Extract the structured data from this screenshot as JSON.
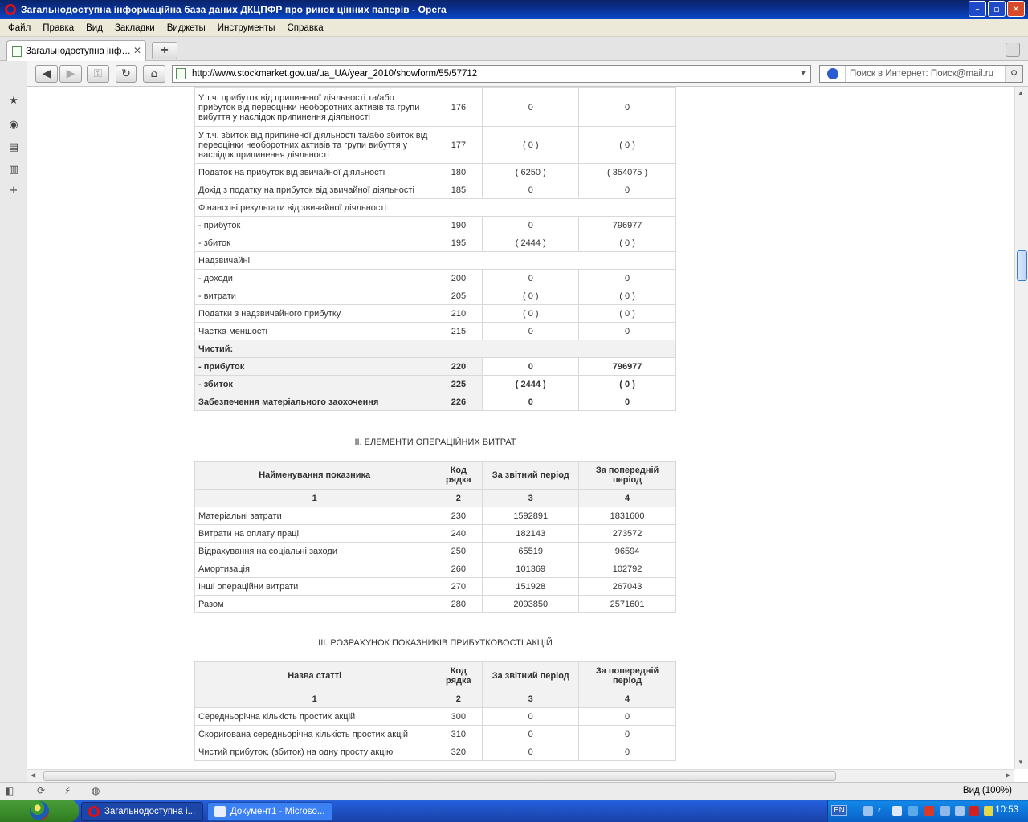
{
  "window": {
    "title": "Загальнодоступна інформаційна база даних ДКЦПФР про ринок цінних паперів - Opera",
    "buttons": [
      "–",
      "▫",
      "✕"
    ]
  },
  "menu": [
    "Файл",
    "Правка",
    "Вид",
    "Закладки",
    "Виджеты",
    "Инструменты",
    "Справка"
  ],
  "tab": {
    "label": "Загальнодоступна інф…"
  },
  "address": {
    "url": "http://www.stockmarket.gov.ua/ua_UA/year_2010/showform/55/57712"
  },
  "search": {
    "placeholder": "Поиск в Интернет: Поиск@mail.ru"
  },
  "table1": {
    "rows": [
      {
        "label": "У т.ч. прибуток від припиненої діяльності та/або прибуток від переоцінки необоротних активів та групи вибуття у наслідок припинення діяльності",
        "code": "176",
        "cur": "0",
        "prev": "0",
        "style": "tall"
      },
      {
        "label": "У т.ч. збиток від припиненої діяльності та/або збиток від переоцінки необоротних активів та групи вибуття у наслідок припинення діяльності",
        "code": "177",
        "cur": "( 0 )",
        "prev": "( 0 )",
        "style": "tall"
      },
      {
        "label": "Податок на прибуток від звичайної діяльності",
        "code": "180",
        "cur": "( 6250 )",
        "prev": "( 354075 )",
        "style": ""
      },
      {
        "label": "Дохід з податку на прибуток від звичайної діяльності",
        "code": "185",
        "cur": "0",
        "prev": "0",
        "style": ""
      },
      {
        "label": "Фінансові результати від звичайної діяльності:",
        "code": "",
        "cur": "",
        "prev": "",
        "style": "span"
      },
      {
        "label": "- прибуток",
        "code": "190",
        "cur": "0",
        "prev": "796977",
        "style": ""
      },
      {
        "label": "- збиток",
        "code": "195",
        "cur": "( 2444 )",
        "prev": "( 0 )",
        "style": ""
      },
      {
        "label": "Надзвичайні:",
        "code": "",
        "cur": "",
        "prev": "",
        "style": "span"
      },
      {
        "label": "- доходи",
        "code": "200",
        "cur": "0",
        "prev": "0",
        "style": ""
      },
      {
        "label": "- витрати",
        "code": "205",
        "cur": "( 0 )",
        "prev": "( 0 )",
        "style": ""
      },
      {
        "label": "Податки з надзвичайного прибутку",
        "code": "210",
        "cur": "( 0 )",
        "prev": "( 0 )",
        "style": ""
      },
      {
        "label": "Частка меншості",
        "code": "215",
        "cur": "0",
        "prev": "0",
        "style": ""
      },
      {
        "label": "Чистий:",
        "code": "",
        "cur": "",
        "prev": "",
        "style": "span-bold"
      },
      {
        "label": "- прибуток",
        "code": "220",
        "cur": "0",
        "prev": "796977",
        "style": "bold"
      },
      {
        "label": "- збиток",
        "code": "225",
        "cur": "( 2444 )",
        "prev": "( 0 )",
        "style": "bold"
      },
      {
        "label": "Забезпечення матеріального заохочення",
        "code": "226",
        "cur": "0",
        "prev": "0",
        "style": "bold"
      }
    ]
  },
  "section2": {
    "title": "ІІ. ЕЛЕМЕНТИ ОПЕРАЦІЙНИХ ВИТРАТ",
    "headers": [
      "Найменування показника",
      "Код рядка",
      "За звітний період",
      "За попередній період"
    ],
    "index": [
      "1",
      "2",
      "3",
      "4"
    ],
    "rows": [
      {
        "label": "Матеріальні затрати",
        "code": "230",
        "cur": "1592891",
        "prev": "1831600"
      },
      {
        "label": "Витрати на оплату праці",
        "code": "240",
        "cur": "182143",
        "prev": "273572"
      },
      {
        "label": "Відрахування на соціальні заходи",
        "code": "250",
        "cur": "65519",
        "prev": "96594"
      },
      {
        "label": "Амортизація",
        "code": "260",
        "cur": "101369",
        "prev": "102792"
      },
      {
        "label": "Інші операційни витрати",
        "code": "270",
        "cur": "151928",
        "prev": "267043"
      },
      {
        "label": "Разом",
        "code": "280",
        "cur": "2093850",
        "prev": "2571601"
      }
    ]
  },
  "section3": {
    "title": "ІІІ. РОЗРАХУНОК ПОКАЗНИКІВ ПРИБУТКОВОСТІ АКЦІЙ",
    "headers": [
      "Назва статті",
      "Код рядка",
      "За звітний період",
      "За попередній період"
    ],
    "index": [
      "1",
      "2",
      "3",
      "4"
    ],
    "rows": [
      {
        "label": "Середньорічна кількість простих акцій",
        "code": "300",
        "cur": "0",
        "prev": "0"
      },
      {
        "label": "Скоригована середньорічна кількість простих акцій",
        "code": "310",
        "cur": "0",
        "prev": "0"
      },
      {
        "label": "Чистий прибуток, (збиток) на одну просту акцію",
        "code": "320",
        "cur": "0",
        "prev": "0"
      }
    ]
  },
  "status": {
    "zoom": "Вид (100%)"
  },
  "taskbar": {
    "tasks": [
      {
        "label": "Загальнодоступна і..."
      },
      {
        "label": "Документ1 - Microso..."
      }
    ],
    "lang": "EN",
    "clock": "10:53"
  },
  "colors": {
    "titlebar": "#0a246a",
    "table_border": "#d9d9d9",
    "table_header_bg": "#f2f2f2",
    "taskbar": "#245edb",
    "start_button": "#3c8f2c"
  }
}
